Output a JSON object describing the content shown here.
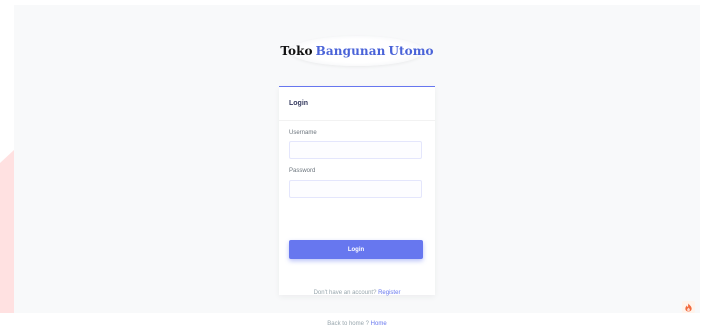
{
  "logo": {
    "word1": "Toko",
    "word2": "Bangunan",
    "word3": "Utomo"
  },
  "login_card": {
    "title": "Login",
    "username_label": "Username",
    "username_value": "",
    "password_label": "Password",
    "password_value": "",
    "login_button": "Login"
  },
  "register_prompt": {
    "text": "Don't have an account?",
    "link": "Register"
  },
  "home_prompt": {
    "text": "Back to home ?",
    "link": "Home"
  },
  "colors": {
    "accent": "#6777ef",
    "logo_blue": "#4a63d8",
    "background": "#f8f9fa"
  },
  "icons": {
    "corner": "flame-icon"
  }
}
